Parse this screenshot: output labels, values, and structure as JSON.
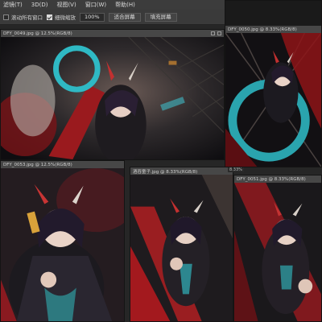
{
  "menu": [
    "滤镜(T)",
    "3D(D)",
    "视图(V)",
    "窗口(W)",
    "帮助(H)"
  ],
  "options": {
    "scroll_all": "滚动所有窗口",
    "fine_zoom": "细微缩放",
    "zoom_value": "100%",
    "fit_screen": "适合屏幕",
    "fill_screen": "填充屏幕"
  },
  "windows": {
    "w1": {
      "title": "DFY_0049.jpg @ 12.5%(RGB/8)"
    },
    "w2": {
      "title": "DFY_0050.jpg @ 8.33%(RGB/8)"
    },
    "w3": {
      "title": "DFY_0053.jpg @ 12.5%(RGB/8)"
    },
    "w4": {
      "title": "酒吞童子.jpg @ 8.33%(RGB/8)"
    },
    "w5": {
      "title": "DFY_0051.jpg @ 8.33%(RGB/8)"
    }
  },
  "status": {
    "zoom": "8.33%"
  },
  "colors": {
    "menubar": "#3c3c3c",
    "optbar": "#3a3a3a",
    "titlebar": "#474747",
    "workspace": "#262626"
  }
}
